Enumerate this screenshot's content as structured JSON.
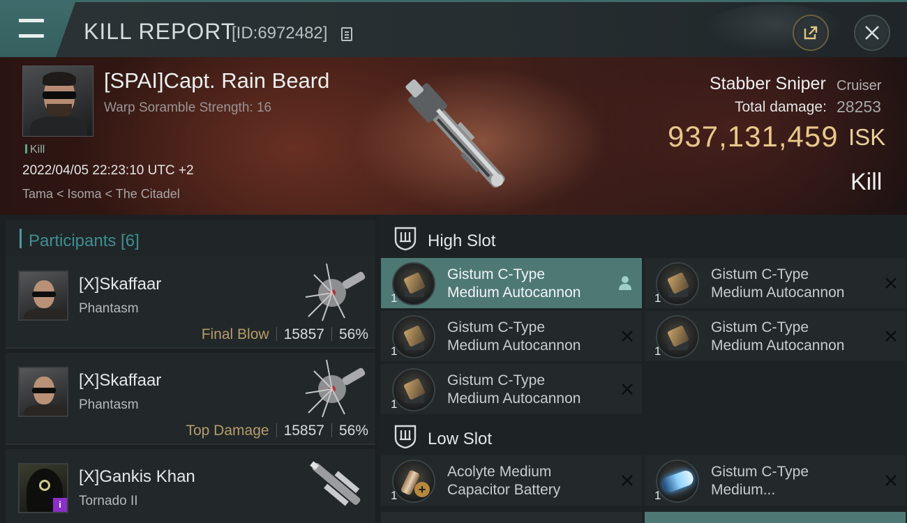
{
  "header": {
    "title": "KILL REPORT",
    "report_id": "[ID:6972482]"
  },
  "victim": {
    "name": "[SPAI]Capt. Rain Beard",
    "warp_scramble": "Warp Soramble Strength: 16",
    "tag": "Kill",
    "datetime": "2022/04/05 22:23:10 UTC +2",
    "location": "Tama < Isoma < The Citadel",
    "ship_name": "Stabber Sniper",
    "ship_class": "Cruiser",
    "total_damage_label": "Total damage:",
    "total_damage": "28253",
    "isk_value": "937,131,459",
    "isk_unit": "ISK",
    "result": "Kill"
  },
  "participants": {
    "title": "Participants [6]",
    "items": [
      {
        "name": "[X]Skaffaar",
        "ship": "Phantasm",
        "label": "Final Blow",
        "damage": "15857",
        "percent": "56%"
      },
      {
        "name": "[X]Skaffaar",
        "ship": "Phantasm",
        "label": "Top Damage",
        "damage": "15857",
        "percent": "56%"
      },
      {
        "name": "[X]Gankis Khan",
        "ship": "Tornado II"
      }
    ]
  },
  "slots": {
    "high": {
      "label": "High Slot",
      "modules": [
        {
          "line1": "Gistum C-Type",
          "line2": "Medium Autocannon",
          "qty": "1"
        },
        {
          "line1": "Gistum C-Type",
          "line2": "Medium Autocannon",
          "qty": "1"
        },
        {
          "line1": "Gistum C-Type",
          "line2": "Medium Autocannon",
          "qty": "1"
        },
        {
          "line1": "Gistum C-Type",
          "line2": "Medium Autocannon",
          "qty": "1"
        },
        {
          "line1": "Gistum C-Type",
          "line2": "Medium Autocannon",
          "qty": "1"
        }
      ]
    },
    "low": {
      "label": "Low Slot",
      "modules": [
        {
          "line1": "Acolyte Medium",
          "line2": "Capacitor Battery",
          "qty": "1"
        },
        {
          "line1": "Gistum C-Type",
          "line2": "Medium...",
          "qty": "1"
        }
      ]
    }
  },
  "colors": {
    "accent_teal": "#4e7874",
    "isk_gold": "#e8c88a",
    "label_gold": "#b59d6a"
  }
}
